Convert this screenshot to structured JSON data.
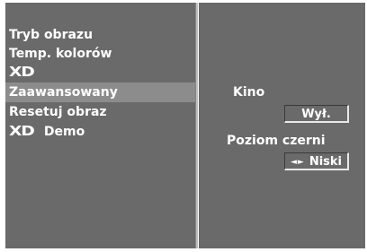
{
  "menu": {
    "items": [
      {
        "label": "Tryb obrazu"
      },
      {
        "label": "Temp. kolorów"
      },
      {
        "logo": "XD"
      },
      {
        "label": "Zaawansowany",
        "selected": true
      },
      {
        "label": "Resetuj obraz"
      },
      {
        "logo": "XD",
        "label": "Demo"
      }
    ]
  },
  "settings": {
    "kino": {
      "label": "Kino",
      "value": "Wył."
    },
    "black_level": {
      "label": "Poziom czerni",
      "value": "Niski",
      "arrows": "◄►"
    }
  },
  "colors": {
    "panel_bg": "#6a6a6a",
    "selected_bg": "#8c8c8c",
    "text": "#ffffff"
  }
}
